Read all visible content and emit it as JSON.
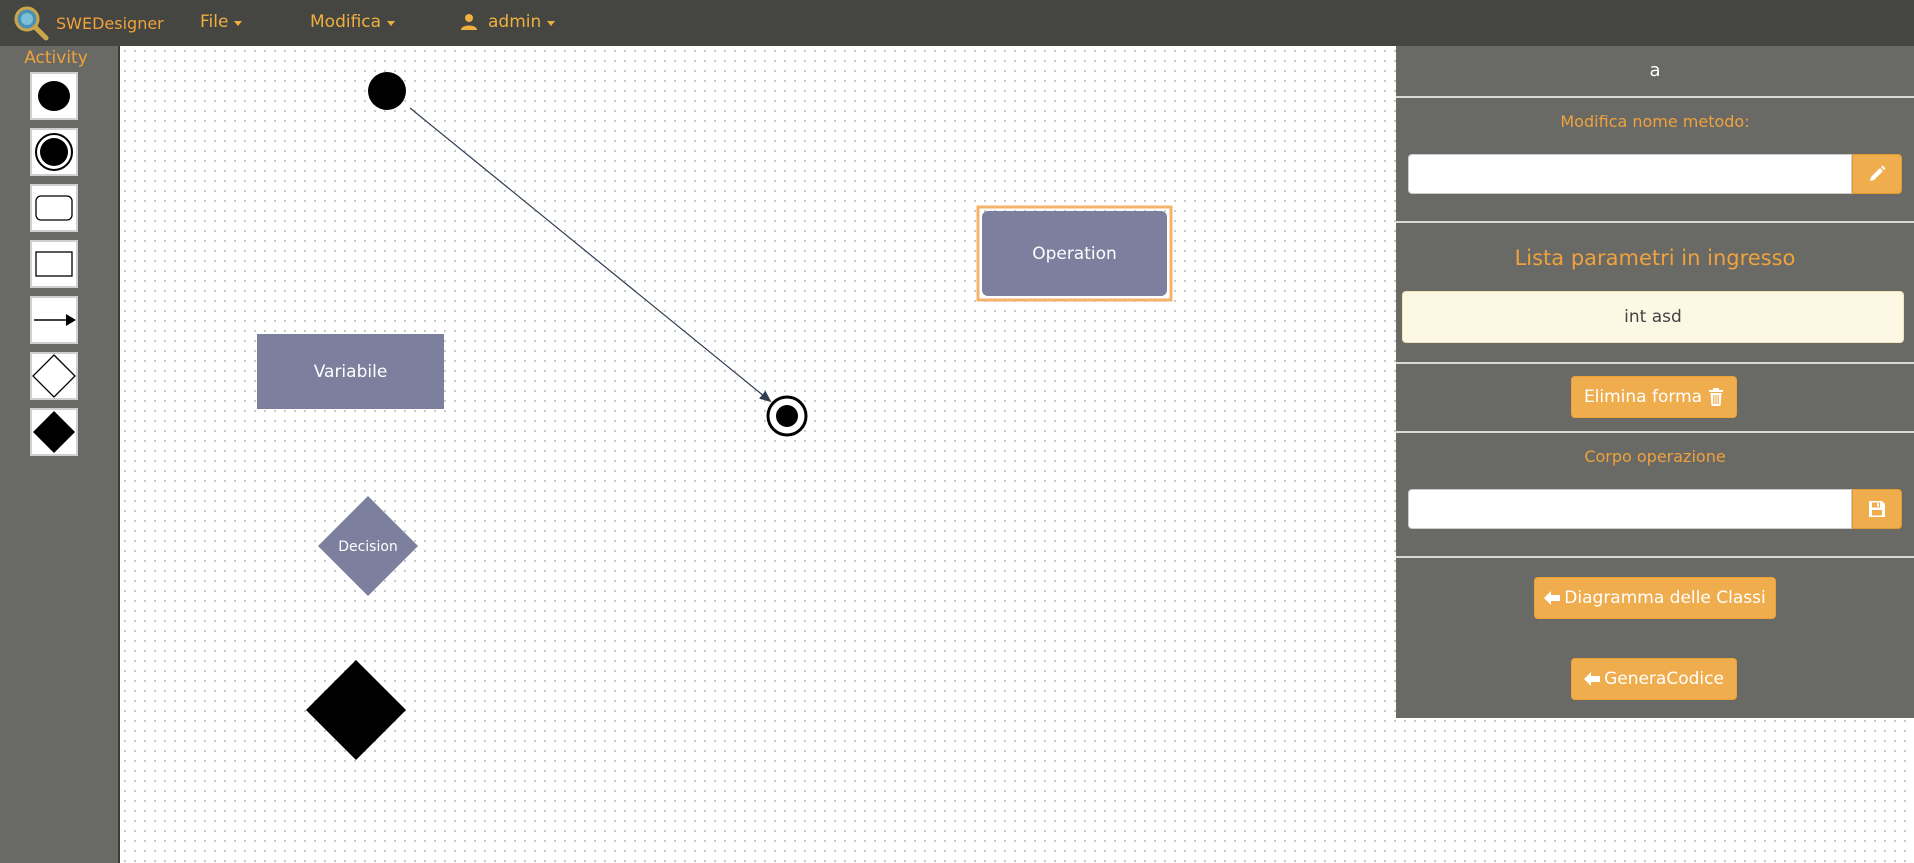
{
  "app": {
    "brand": "SWEDesigner"
  },
  "nav": {
    "file_label": "File",
    "modifica_label": "Modifica",
    "user_label": "admin"
  },
  "toolbar": {
    "title": "Activity",
    "tools": [
      {
        "icon": "initial-node-icon"
      },
      {
        "icon": "final-node-icon"
      },
      {
        "icon": "rounded-rectangle-icon"
      },
      {
        "icon": "rectangle-icon"
      },
      {
        "icon": "arrow-icon"
      },
      {
        "icon": "diamond-outline-icon"
      },
      {
        "icon": "diamond-filled-icon"
      }
    ]
  },
  "diagram": {
    "operation_label": "Operation",
    "variable_label": "Variabile",
    "decision_label": "Decision"
  },
  "panel": {
    "title": "a",
    "rename_label": "Modifica nome metodo:",
    "rename_value": "",
    "params_heading": "Lista parametri in ingresso",
    "params": [
      "int asd"
    ],
    "delete_label": "Elimina forma",
    "body_label": "Corpo operazione",
    "body_value": "",
    "class_diagram_label": "Diagramma delle Classi",
    "generate_label": "GeneraCodice"
  },
  "colors": {
    "navbar": "#454541",
    "accent": "#f0a23c",
    "button": "#f0ad4e",
    "panel": "#696966",
    "shape_fill": "#7c7f9e",
    "selection": "#f5b36a"
  }
}
